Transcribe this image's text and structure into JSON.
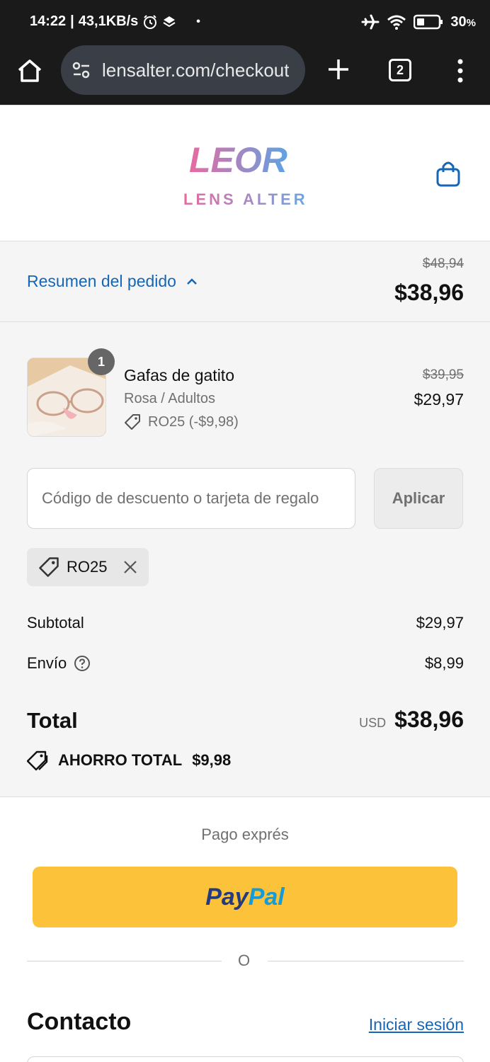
{
  "status_bar": {
    "time": "14:22",
    "network_speed": "43,1KB/s",
    "battery": "30",
    "battery_unit": "%",
    "icons": [
      "alarm-icon",
      "layers-icon",
      "airplane-mode-icon",
      "wifi-icon",
      "battery-icon"
    ]
  },
  "browser": {
    "url": "lensalter.com/checkout",
    "tab_count": "2"
  },
  "header": {
    "brand_name": "LENS ALTER",
    "logo_text": "LEOR"
  },
  "summary_toggle": {
    "label": "Resumen del pedido",
    "original_total": "$48,94",
    "total": "$38,96"
  },
  "line_item": {
    "quantity": "1",
    "title": "Gafas de gatito",
    "variant": "Rosa / Adultos",
    "discount": "RO25 (-$9,98)",
    "original_price": "$39,95",
    "price": "$29,97"
  },
  "discount_form": {
    "placeholder": "Código de descuento o tarjeta de regalo",
    "apply_label": "Aplicar",
    "applied_code": "RO25"
  },
  "totals": {
    "subtotal_label": "Subtotal",
    "subtotal_value": "$29,97",
    "shipping_label": "Envío",
    "shipping_value": "$8,99",
    "total_label": "Total",
    "currency": "USD",
    "total_value": "$38,96",
    "savings_label": "AHORRO TOTAL",
    "savings_value": "$9,98"
  },
  "express": {
    "label": "Pago exprés",
    "paypal_pay": "Pay",
    "paypal_pal": "Pal",
    "divider": "O"
  },
  "contact": {
    "title": "Contacto",
    "login_link": "Iniciar sesión"
  },
  "colors": {
    "link": "#1666b5",
    "paypal_yellow": "#fcc33a",
    "paypal_dark_blue": "#253b80",
    "paypal_light_blue": "#179bd7",
    "summary_bg": "#f5f5f5"
  }
}
